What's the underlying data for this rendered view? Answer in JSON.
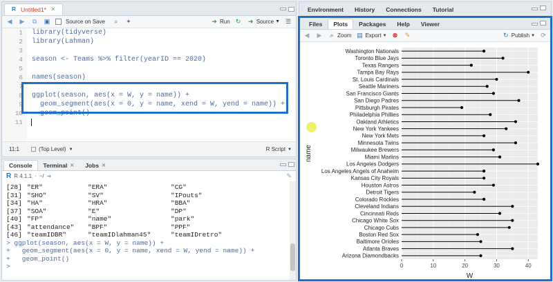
{
  "editor": {
    "tab_label": "Untitled1*",
    "source_on_save": "Source on Save",
    "run_label": "Run",
    "source_label": "Source",
    "lines": [
      {
        "n": "1",
        "text": "library(tidyverse)"
      },
      {
        "n": "2",
        "text": "library(Lahman)"
      },
      {
        "n": "3",
        "text": ""
      },
      {
        "n": "4",
        "text": "season <- Teams %>% filter(yearID == 2020)"
      },
      {
        "n": "5",
        "text": ""
      },
      {
        "n": "6",
        "text": "names(season)"
      },
      {
        "n": "7",
        "text": ""
      },
      {
        "n": "8",
        "text": "ggplot(season, aes(x = W, y = name)) +"
      },
      {
        "n": "9",
        "text": "  geom_segment(aes(x = 0, y = name, xend = W, yend = name)) +"
      },
      {
        "n": "10",
        "text": "  geom_point()"
      },
      {
        "n": "11",
        "text": ""
      }
    ],
    "cursor_pos": "11:1",
    "scope": "(Top Level)",
    "file_type": "R Script"
  },
  "console": {
    "tabs": [
      "Console",
      "Terminal",
      "Jobs"
    ],
    "version": "R 4.1.1",
    "path": "~/",
    "rows": [
      [
        "[28]",
        "\"ER\"",
        "\"ERA\"",
        "\"CG\""
      ],
      [
        "[31]",
        "\"SHO\"",
        "\"SV\"",
        "\"IPouts\""
      ],
      [
        "[34]",
        "\"HA\"",
        "\"HRA\"",
        "\"BBA\""
      ],
      [
        "[37]",
        "\"SOA\"",
        "\"E\"",
        "\"DP\""
      ],
      [
        "[40]",
        "\"FP\"",
        "\"name\"",
        "\"park\""
      ],
      [
        "[43]",
        "\"attendance\"",
        "\"BPF\"",
        "\"PPF\""
      ],
      [
        "[46]",
        "\"teamIDBR\"",
        "\"teamIDlahman45\"",
        "\"teamIDretro\""
      ]
    ],
    "commands": [
      "> ggplot(season, aes(x = W, y = name)) +",
      "+   geom_segment(aes(x = 0, y = name, xend = W, yend = name)) +",
      "+   geom_point()",
      ">"
    ]
  },
  "env_tabs": [
    "Environment",
    "History",
    "Connections",
    "Tutorial"
  ],
  "files_tabs": [
    "Files",
    "Plots",
    "Packages",
    "Help",
    "Viewer"
  ],
  "plots_toolbar": {
    "zoom": "Zoom",
    "export": "Export",
    "publish": "Publish"
  },
  "colors": {
    "highlight": "#1f6fc5",
    "code": "#4a6aa0",
    "accent": "#e0a800"
  },
  "chart_data": {
    "type": "scatter",
    "xlabel": "W",
    "ylabel": "name",
    "xlim": [
      0,
      43
    ],
    "xticks": [
      0,
      10,
      20,
      30,
      40
    ],
    "grid": true,
    "categories": [
      "Washington Nationals",
      "Toronto Blue Jays",
      "Texas Rangers",
      "Tampa Bay Rays",
      "St. Louis Cardinals",
      "Seattle Mariners",
      "San Francisco Giants",
      "San Diego Padres",
      "Pittsburgh Pirates",
      "Philadelphia Phillies",
      "Oakland Athletics",
      "New York Yankees",
      "New York Mets",
      "Minnesota Twins",
      "Milwaukee Brewers",
      "Miami Marlins",
      "Los Angeles Dodgers",
      "Los Angeles Angels of Anaheim",
      "Kansas City Royals",
      "Houston Astros",
      "Detroit Tigers",
      "Colorado Rockies",
      "Cleveland Indians",
      "Cincinnati Reds",
      "Chicago White Sox",
      "Chicago Cubs",
      "Boston Red Sox",
      "Baltimore Orioles",
      "Atlanta Braves",
      "Arizona Diamondbacks"
    ],
    "values": [
      26,
      32,
      22,
      40,
      30,
      27,
      29,
      37,
      19,
      28,
      36,
      33,
      26,
      36,
      29,
      31,
      43,
      26,
      26,
      29,
      23,
      26,
      35,
      31,
      35,
      34,
      24,
      25,
      35,
      25
    ]
  }
}
